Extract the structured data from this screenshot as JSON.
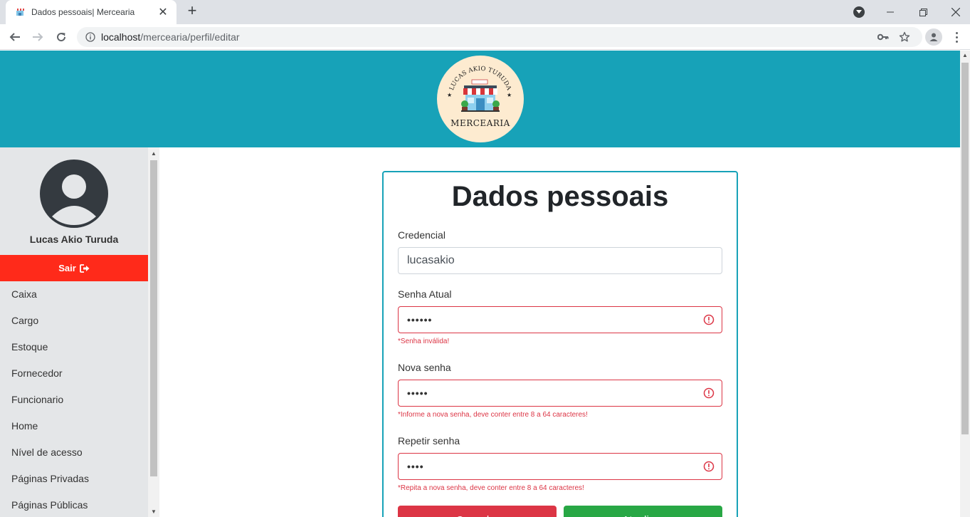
{
  "browser": {
    "tab_title": "Dados pessoais| Mercearia",
    "url_host": "localhost",
    "url_path": "/mercearia/perfil/editar"
  },
  "header": {
    "logo_top_text": "LUCAS AKIO TURUDA",
    "logo_bottom_text": "MERCEARIA"
  },
  "sidebar": {
    "user_name": "Lucas Akio Turuda",
    "logout_label": "Sair",
    "items": [
      {
        "label": "Caixa"
      },
      {
        "label": "Cargo"
      },
      {
        "label": "Estoque"
      },
      {
        "label": "Fornecedor"
      },
      {
        "label": "Funcionario"
      },
      {
        "label": "Home"
      },
      {
        "label": "Nível de acesso"
      },
      {
        "label": "Páginas Privadas"
      },
      {
        "label": "Páginas Públicas"
      }
    ]
  },
  "form": {
    "title": "Dados pessoais",
    "credential": {
      "label": "Credencial",
      "value": "lucasakio"
    },
    "current_password": {
      "label": "Senha Atual",
      "value": "••••••",
      "error": "*Senha inválida!"
    },
    "new_password": {
      "label": "Nova senha",
      "value": "•••••",
      "error": "*Informe a nova senha, deve conter entre 8 a 64 caracteres!"
    },
    "repeat_password": {
      "label": "Repetir senha",
      "value": "••••",
      "error": "*Repita a nova senha, deve conter entre 8 a 64 caracteres!"
    },
    "cancel_label": "Cancelar",
    "save_label": "Atualizar"
  },
  "colors": {
    "header": "#17a2b8",
    "danger": "#dc3545",
    "success": "#28a745",
    "logout": "#ff2a1a"
  }
}
